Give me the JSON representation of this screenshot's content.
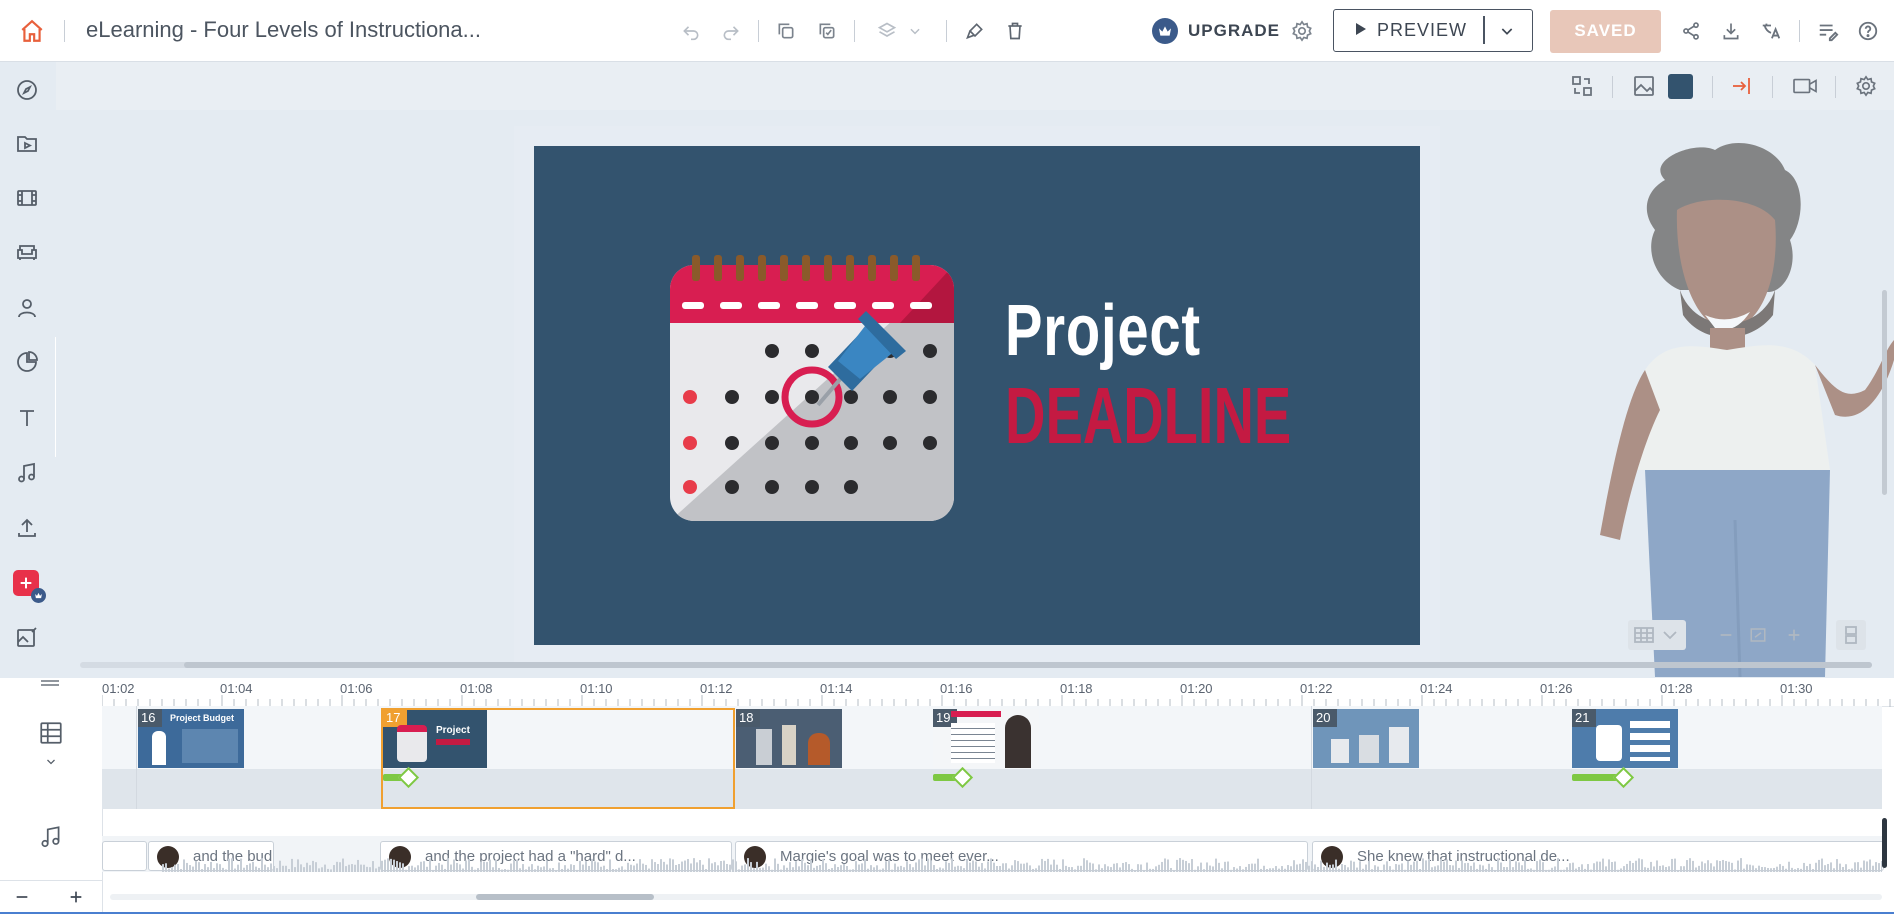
{
  "header": {
    "title": "eLearning - Four Levels of Instructiona...",
    "upgrade_label": "UPGRADE",
    "preview_label": "PREVIEW",
    "saved_label": "SAVED"
  },
  "slide": {
    "title_line1": "Project",
    "title_line2": "DEADLINE"
  },
  "timeline": {
    "ruler": [
      "01:02",
      "01:04",
      "01:06",
      "01:08",
      "01:10",
      "01:12",
      "01:14",
      "01:16",
      "01:18",
      "01:20",
      "01:22",
      "01:24",
      "01:26",
      "01:28",
      "01:30"
    ],
    "scenes": [
      {
        "num": "16",
        "thumb_title": "Project Budget"
      },
      {
        "num": "17",
        "thumb_title": "Project"
      },
      {
        "num": "18",
        "thumb_title": ""
      },
      {
        "num": "19",
        "thumb_title": ""
      },
      {
        "num": "20",
        "thumb_title": ""
      },
      {
        "num": "21",
        "thumb_title": ""
      }
    ],
    "audio_clips": [
      {
        "text": "and the bud"
      },
      {
        "text": "and the project had a \"hard\" d..."
      },
      {
        "text": "Margie's goal was to meet ever..."
      },
      {
        "text": "She knew that instructional de..."
      }
    ]
  },
  "colors": {
    "accent": "#e8603c",
    "saved_bg": "#e8c7b9",
    "slide_bg": "#33536e",
    "deadline_red": "#c41a42",
    "selected_scene": "#f0a030",
    "anim_bar": "#7ec843"
  },
  "icons": [
    "home-icon",
    "undo-icon",
    "redo-icon",
    "copy-icon",
    "duplicate-icon",
    "layers-icon",
    "paint-icon",
    "trash-icon",
    "crown-icon",
    "settings-icon",
    "share-icon",
    "download-icon",
    "translate-icon",
    "notes-icon",
    "help-icon"
  ]
}
